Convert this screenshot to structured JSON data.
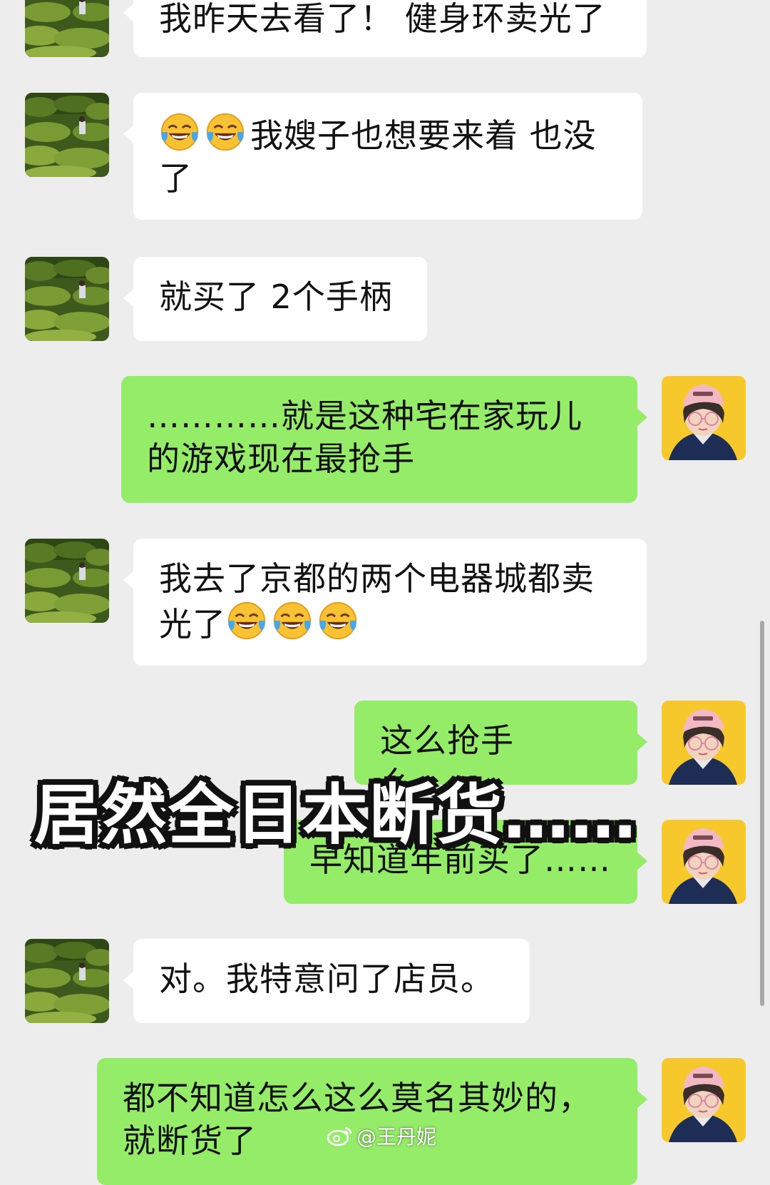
{
  "messages": [
    {
      "side": "left",
      "text": "我昨天去看了！ 健身环卖光了"
    },
    {
      "side": "left",
      "emoji_prefix": 2,
      "text": "我嫂子也想要来着 也没了"
    },
    {
      "side": "left",
      "text": "就买了 2个手柄"
    },
    {
      "side": "right",
      "text": "…………就是这种宅在家玩儿的游戏现在最抢手"
    },
    {
      "side": "left",
      "text": "我去了京都的两个电器城都卖光了",
      "emoji_suffix": 3
    },
    {
      "side": "right",
      "text": "这么抢手么……"
    },
    {
      "side": "right",
      "text": "早知道年前买了……"
    },
    {
      "side": "left",
      "text": "对。我特意问了店员。"
    },
    {
      "side": "right",
      "text": "都不知道怎么这么莫名其妙的，就断货了"
    }
  ],
  "overlay_caption": "居然全日本断货……",
  "watermark": {
    "handle": "@王丹妮",
    "icon": "weibo-icon"
  },
  "emoji_name": "tears-of-joy-emoji",
  "colors": {
    "background": "#ededed",
    "bubble_left": "#ffffff",
    "bubble_right": "#95ec69"
  }
}
